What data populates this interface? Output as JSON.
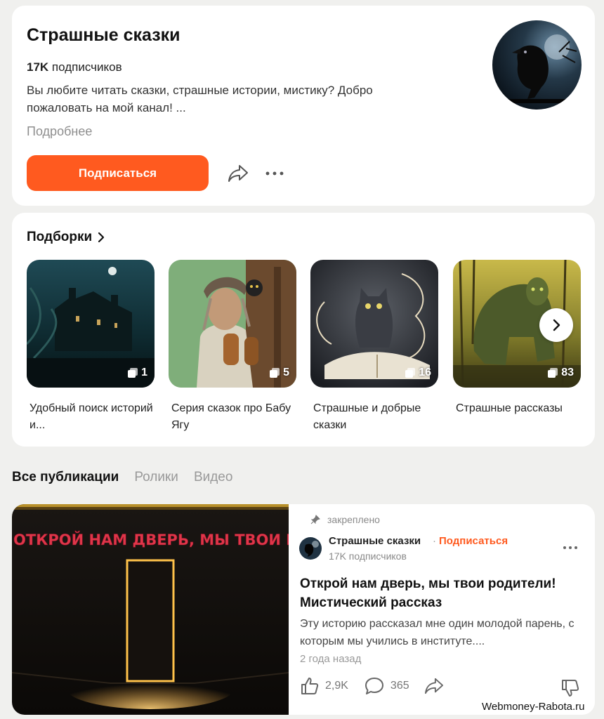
{
  "channel": {
    "title": "Страшные сказки",
    "subscribers_count": "17K",
    "subscribers_word": "подписчиков",
    "description": "Вы любите читать сказки, страшные истории, мистику? Добро пожаловать на мой канал! ...",
    "more_link": "Подробнее",
    "subscribe_label": "Подписаться",
    "accent_color": "#ff5a1f"
  },
  "collections": {
    "heading": "Подборки",
    "items": [
      {
        "label": "Удобный поиск историй и...",
        "count": "1"
      },
      {
        "label": "Серия сказок про Бабу Ягу",
        "count": "5"
      },
      {
        "label": "Страшные и добрые сказки",
        "count": "16"
      },
      {
        "label": "Страшные рассказы",
        "count": "83"
      }
    ]
  },
  "tabs": [
    {
      "label": "Все публикации",
      "active": true
    },
    {
      "label": "Ролики",
      "active": false
    },
    {
      "label": "Видео",
      "active": false
    }
  ],
  "post": {
    "image_caption": "ОТКРОЙ НАМ ДВЕРЬ, МЫ ТВОИ РОДИТЕЛ",
    "pinned_label": "закреплено",
    "author": "Страшные сказки",
    "subscribe_dot": "·",
    "subscribe_label": "Подписаться",
    "author_subscribers": "17K подписчиков",
    "title": "Открой нам дверь, мы твои родители! Мистический рассказ",
    "excerpt": "Эту историю рассказал мне один молодой парень, с которым мы учились в институте....",
    "date": "2 года назад",
    "likes": "2,9K",
    "comments": "365"
  },
  "watermark": "Webmoney-Rabota.ru"
}
